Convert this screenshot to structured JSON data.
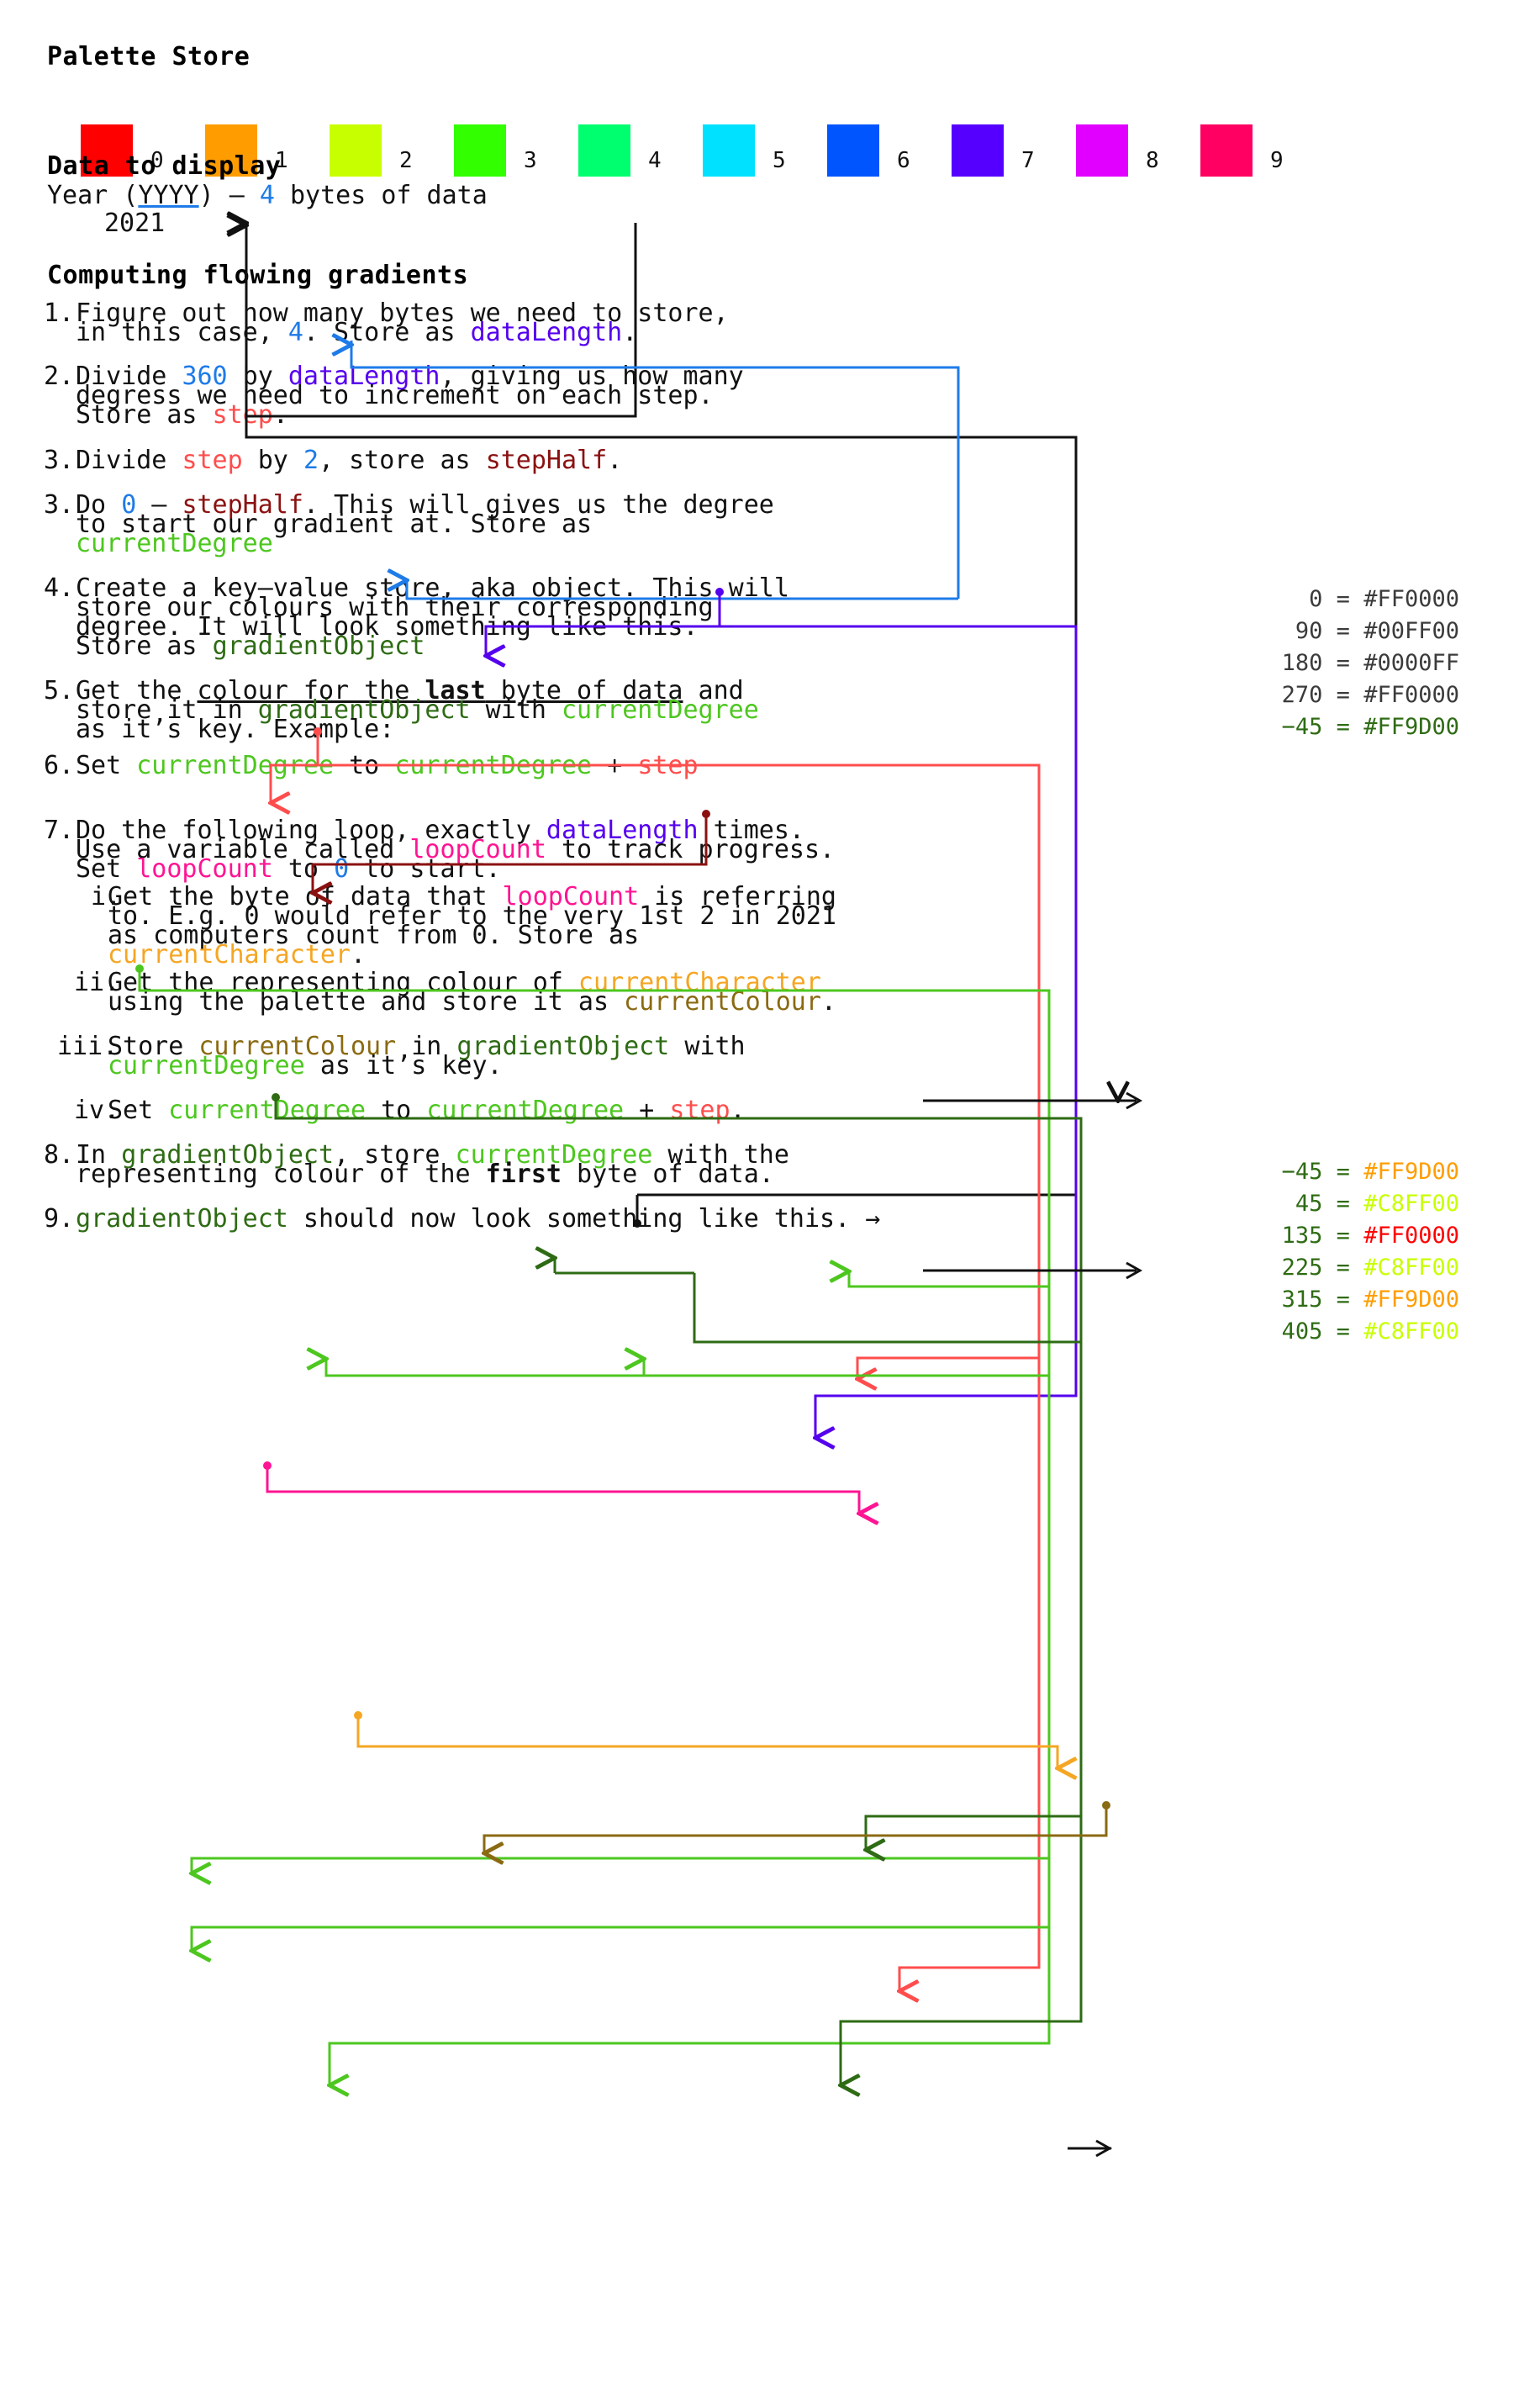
{
  "palette": {
    "title": "Palette Store",
    "swatches": [
      {
        "index": "0",
        "color": "#FF0000"
      },
      {
        "index": "1",
        "color": "#FF9D00"
      },
      {
        "index": "2",
        "color": "#C8FF00"
      },
      {
        "index": "3",
        "color": "#32FF00"
      },
      {
        "index": "4",
        "color": "#00FF6E"
      },
      {
        "index": "5",
        "color": "#00E1FF"
      },
      {
        "index": "6",
        "color": "#0055FF"
      },
      {
        "index": "7",
        "color": "#5500FF"
      },
      {
        "index": "8",
        "color": "#E100FF"
      },
      {
        "index": "9",
        "color": "#FF0062"
      }
    ]
  },
  "data_to_display": {
    "title": "Data to display",
    "line_prefix": "Year (",
    "line_yyyy": "YYYY",
    "line_mid": ") — ",
    "line_bytes": "4",
    "line_suffix": " bytes of data",
    "value": "2021"
  },
  "steps_section": {
    "title": "Computing flowing gradients"
  },
  "steps": {
    "s1": {
      "num": "1.",
      "l1": "Figure out how many bytes we need to store,",
      "l2a": "in this case, ",
      "l2num": "4",
      "l2b": ". Store as ",
      "l2var": "dataLength",
      "l2c": "."
    },
    "s2": {
      "num": "2.",
      "l1a": "Divide ",
      "l1num": "360",
      "l1b": " by ",
      "l1var": "dataLength",
      "l1c": ", giving us how many",
      "l2": "degress we need to increment on each step.",
      "l3a": "Store as ",
      "l3var": "step",
      "l3b": "."
    },
    "s3a": {
      "num": "3.",
      "l1a": "Divide ",
      "l1var": "step",
      "l1b": " by ",
      "l1num": "2",
      "l1c": ", store as ",
      "l1var2": "stepHalf",
      "l1d": "."
    },
    "s3b": {
      "num": "3.",
      "l1a": "Do ",
      "l1num": "0",
      "l1b": " — ",
      "l1var": "stepHalf",
      "l1c": ". This will gives us the degree",
      "l2": "to start our gradient at. Store as",
      "l3var": "currentDegree"
    },
    "s4": {
      "num": "4.",
      "l1": "Create a key—value store, aka object. This will",
      "l2": "store our colours with their corresponding",
      "l3": "degree. It will look something like this.",
      "l4a": "Store as ",
      "l4var": "gradientObject"
    },
    "s5": {
      "num": "5.",
      "l1a": "Get the ",
      "l1u1": "colour for the ",
      "l1bold": "last",
      "l1u2": " byte of data",
      "l1b": " and",
      "l2a": "store it in ",
      "l2var1": "gradientObject",
      "l2b": " with ",
      "l2var2": "currentDegree",
      "l3": "as it’s key. Example:"
    },
    "s6": {
      "num": "6.",
      "l1a": "Set ",
      "l1var1": "currentDegree",
      "l1b": " to ",
      "l1var2": "currentDegree",
      "l1c": " + ",
      "l1var3": "step"
    },
    "s7": {
      "num": "7.",
      "l1a": "Do the following loop, exactly ",
      "l1var": "dataLength",
      "l1b": " times.",
      "l2a": "Use a variable called ",
      "l2var": "loopCount",
      "l2b": " to track progress.",
      "l3a": "Set ",
      "l3var": "loopCount",
      "l3b": " to ",
      "l3num": "0",
      "l3c": " to start."
    },
    "s7i": {
      "num": "i.",
      "l1a": "Get the byte of data that ",
      "l1var": "loopCount",
      "l1b": " is referring",
      "l2": "to. E.g. 0 would refer to the very 1st 2 in 2021",
      "l3": "as computers count from 0. Store as",
      "l4var": "currentCharacter",
      "l4b": "."
    },
    "s7ii": {
      "num": "ii.",
      "l1a": "Get the representing colour of ",
      "l1var": "currentCharacter",
      "l2a": "using the palette and store it as ",
      "l2var": "currentColour",
      "l2b": "."
    },
    "s7iii": {
      "num": "iii.",
      "l1a": "Store ",
      "l1var1": "currentColour",
      "l1b": " in ",
      "l1var2": "gradientObject",
      "l1c": " with",
      "l2var": "currentDegree",
      "l2b": " as it’s key."
    },
    "s7iv": {
      "num": "iv.",
      "l1a": "Set ",
      "l1var1": "currentDegree",
      "l1b": " to ",
      "l1var2": "currentDegree",
      "l1c": " + ",
      "l1var3": "step",
      "l1d": "."
    },
    "s8": {
      "num": "8.",
      "l1a": "In ",
      "l1var1": "gradientObject",
      "l1b": ", store ",
      "l1var2": "currentDegree",
      "l1c": " with the",
      "l2a": "representing colour of the ",
      "l2bold": "first",
      "l2b": " byte of data."
    },
    "s9": {
      "num": "9.",
      "l1var": "gradientObject",
      "l1a": " should now look something like this. →"
    }
  },
  "example_object": {
    "rows": [
      {
        "key": "0",
        "eq": "=",
        "value": "#FF0000"
      },
      {
        "key": "90",
        "eq": "=",
        "value": "#00FF00"
      },
      {
        "key": "180",
        "eq": "=",
        "value": "#0000FF"
      },
      {
        "key": "270",
        "eq": "=",
        "value": "#FF0000"
      }
    ]
  },
  "example_pair": {
    "key": "−45",
    "eq": "=",
    "value": "#FF9D00"
  },
  "final_object": {
    "rows": [
      {
        "key": "−45",
        "eq": "=",
        "value": "#FF9D00",
        "color": "#FF9D00"
      },
      {
        "key": "45",
        "eq": "=",
        "value": "#C8FF00",
        "color": "#C8FF00"
      },
      {
        "key": "135",
        "eq": "=",
        "value": "#FF0000",
        "color": "#FF0000"
      },
      {
        "key": "225",
        "eq": "=",
        "value": "#C8FF00",
        "color": "#C8FF00"
      },
      {
        "key": "315",
        "eq": "=",
        "value": "#FF9D00",
        "color": "#FF9D00"
      },
      {
        "key": "405",
        "eq": "=",
        "value": "#C8FF00",
        "color": "#C8FF00"
      }
    ]
  },
  "wire_colors": {
    "black": "#111111",
    "blue": "#1E7BE8",
    "violet": "#5500EE",
    "red": "#FF4D4D",
    "darkred": "#8B1111",
    "green": "#4DC71F",
    "darkgreen": "#2E6B14",
    "pink": "#FF1493",
    "orange": "#F5A623",
    "brown": "#8A6A12"
  }
}
